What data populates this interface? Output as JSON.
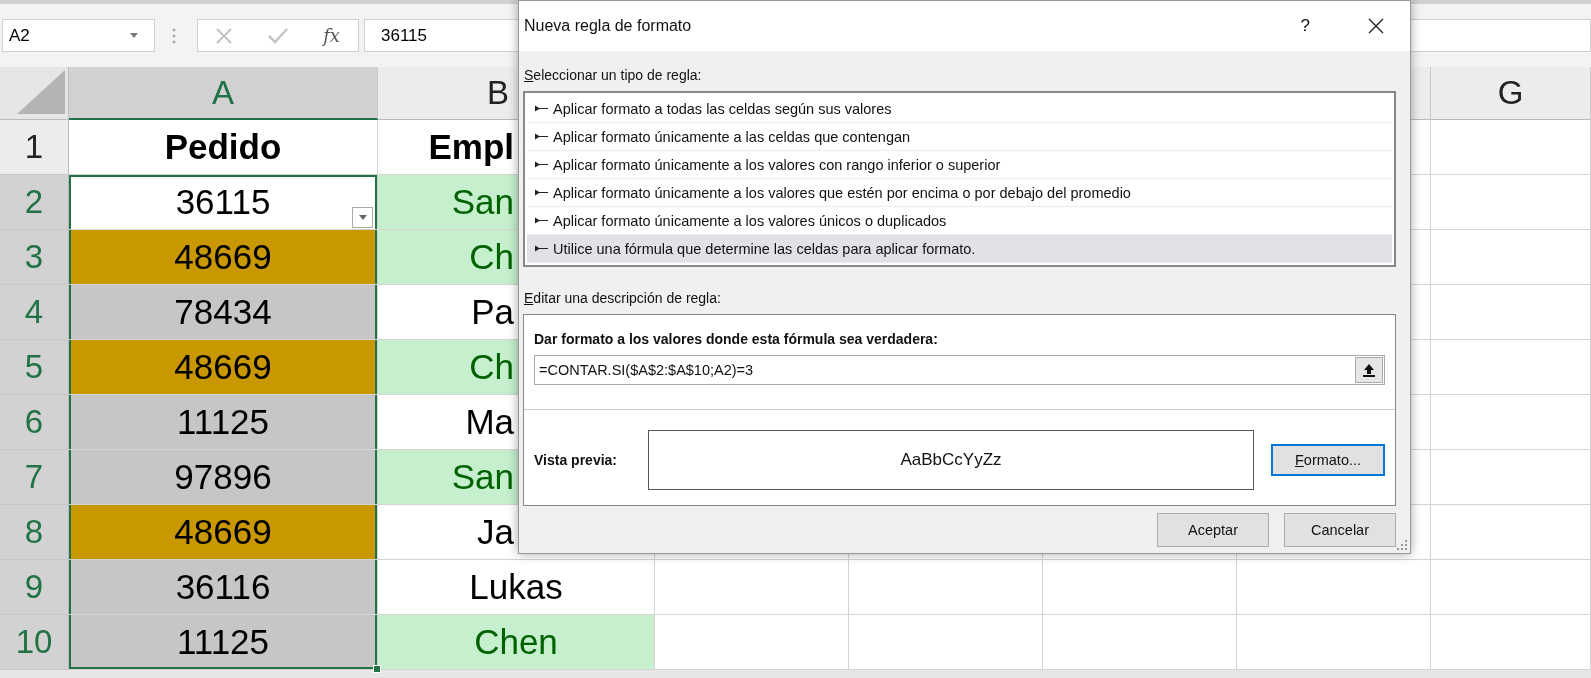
{
  "formula_bar": {
    "name_box": "A2",
    "function_label": "fx",
    "formula": "36115"
  },
  "columns": [
    {
      "label": "A",
      "selected": true
    },
    {
      "label": "B",
      "selected": false
    },
    {
      "label": "G",
      "selected": false
    }
  ],
  "rows": [
    {
      "header": "1",
      "selected": false,
      "cells": [
        {
          "text": "Pedido",
          "selected": false,
          "active": false
        },
        {
          "text": "Empl",
          "selected": false
        }
      ]
    },
    {
      "header": "2",
      "selected": true,
      "cells": [
        {
          "text": "36115",
          "selected": true,
          "active": true
        },
        {
          "text": "San",
          "selected": false,
          "color": "#c6efce"
        }
      ]
    },
    {
      "header": "3",
      "selected": true,
      "cells": [
        {
          "text": "48669",
          "selected": true,
          "active": false,
          "color": "#c99700"
        },
        {
          "text": "Ch",
          "selected": false,
          "color": "#c6efce"
        }
      ]
    },
    {
      "header": "4",
      "selected": true,
      "cells": [
        {
          "text": "78434",
          "selected": true,
          "active": false
        },
        {
          "text": "Pa",
          "selected": false
        }
      ]
    },
    {
      "header": "5",
      "selected": true,
      "cells": [
        {
          "text": "48669",
          "selected": true,
          "active": false,
          "color": "#c99700"
        },
        {
          "text": "Ch",
          "selected": false,
          "color": "#c6efce"
        }
      ]
    },
    {
      "header": "6",
      "selected": true,
      "cells": [
        {
          "text": "11125",
          "selected": true,
          "active": false
        },
        {
          "text": "Ma",
          "selected": false
        }
      ]
    },
    {
      "header": "7",
      "selected": true,
      "cells": [
        {
          "text": "97896",
          "selected": true,
          "active": false
        },
        {
          "text": "San",
          "selected": false,
          "color": "#c6efce"
        }
      ]
    },
    {
      "header": "8",
      "selected": true,
      "cells": [
        {
          "text": "48669",
          "selected": true,
          "active": false,
          "color": "#c99700"
        },
        {
          "text": "Ja",
          "selected": false
        }
      ]
    },
    {
      "header": "9",
      "selected": true,
      "cells": [
        {
          "text": "36116",
          "selected": true,
          "active": false
        },
        {
          "text": "Lukas",
          "selected": false
        }
      ]
    },
    {
      "header": "10",
      "selected": true,
      "cells": [
        {
          "text": "11125",
          "selected": true,
          "active": false
        },
        {
          "text": "Chen",
          "selected": false,
          "color": "#c6efce"
        }
      ]
    }
  ],
  "dialog": {
    "title": "Nueva regla de formato",
    "help": "?",
    "rule_type_label": "Seleccionar un tipo de regla:",
    "rule_types": [
      {
        "label": "Aplicar formato a todas las celdas según sus valores",
        "selected": false
      },
      {
        "label": "Aplicar formato únicamente a las celdas que contengan",
        "selected": false
      },
      {
        "label": "Aplicar formato únicamente a los valores con rango inferior o superior",
        "selected": false
      },
      {
        "label": "Aplicar formato únicamente a los valores que estén por encima o por debajo del promedio",
        "selected": false
      },
      {
        "label": "Aplicar formato únicamente a los valores únicos o duplicados",
        "selected": false
      },
      {
        "label": "Utilice una fórmula que determine las celdas para aplicar formato.",
        "selected": true
      }
    ],
    "description_label": "Editar una descripción de regla:",
    "formula_label": "Dar formato a los valores donde esta fórmula sea verdadera:",
    "formula": "=CONTAR.SI($A$2:$A$10;A2)=3",
    "preview_label": "Vista previa:",
    "preview_text": "AaBbCcYyZz",
    "format_button": "Formato...",
    "buttons": [
      "Aceptar",
      "Cancelar"
    ]
  }
}
